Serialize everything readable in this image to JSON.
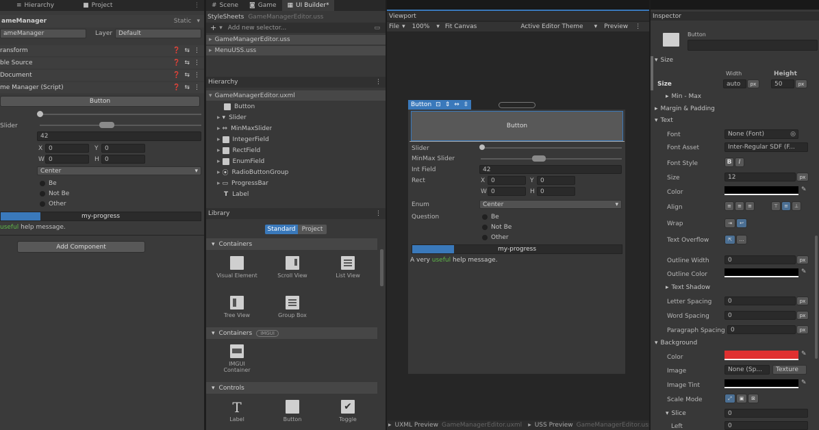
{
  "left": {
    "tabs": [
      {
        "label": "Hierarchy",
        "icon": "hierarchy-icon"
      },
      {
        "label": "Project",
        "icon": "folder-icon"
      }
    ],
    "object_name": "ameManager",
    "static_label": "Static",
    "tag_value": "ameManager",
    "layer_label": "Layer",
    "layer_value": "Default",
    "components": [
      "ransform",
      "ble Source",
      "Document",
      "me Manager (Script)"
    ],
    "preview_button": "Button",
    "slider_label": "Slider",
    "int_value": "42",
    "rect": {
      "x_label": "X",
      "x": "0",
      "y_label": "Y",
      "y": "0",
      "w_label": "W",
      "w": "0",
      "h_label": "H",
      "h": "0"
    },
    "enum_value": "Center",
    "radios": [
      "Be",
      "Not Be",
      "Other"
    ],
    "progress_title": "my-progress",
    "progress_value": 0.2,
    "help_highlight": "useful",
    "help_rest": " help message.",
    "add_component": "Add Component"
  },
  "middle": {
    "tabs": [
      {
        "label": "Scene",
        "icon": "scene-icon"
      },
      {
        "label": "Game",
        "icon": "game-icon"
      },
      {
        "label": "UI Builder*",
        "icon": "ui-builder-icon"
      }
    ],
    "stylesheets_title": "StyleSheets",
    "stylesheets_file": "GameManagerEditor.uss",
    "add_selector_placeholder": "Add new selector...",
    "stylesheet_items": [
      "GameManagerEditor.uss",
      "MenuUSS.uss"
    ],
    "hierarchy_title": "Hierarchy",
    "hierarchy_root": "GameManagerEditor.uxml",
    "hierarchy_items": [
      {
        "label": "Button",
        "icon": "button-element-icon"
      },
      {
        "label": "Slider",
        "icon": "slider-element-icon"
      },
      {
        "label": "MinMaxSlider",
        "icon": "minmax-slider-icon"
      },
      {
        "label": "IntegerField",
        "icon": "integer-field-icon"
      },
      {
        "label": "RectField",
        "icon": "rect-field-icon"
      },
      {
        "label": "EnumField",
        "icon": "enum-field-icon"
      },
      {
        "label": "RadioButtonGroup",
        "icon": "radio-group-icon"
      },
      {
        "label": "ProgressBar",
        "icon": "progress-bar-icon"
      },
      {
        "label": "Label",
        "icon": "label-element-icon"
      }
    ],
    "library_title": "Library",
    "library_tabs": [
      "Standard",
      "Project"
    ],
    "sections": [
      {
        "label": "Containers",
        "badge": "",
        "items": [
          {
            "label": "Visual Element",
            "icon": "visual-element-icon"
          },
          {
            "label": "Scroll View",
            "icon": "scroll-view-icon"
          },
          {
            "label": "List View",
            "icon": "list-view-icon"
          },
          {
            "label": "Tree View",
            "icon": "tree-view-icon"
          },
          {
            "label": "Group Box",
            "icon": "group-box-icon"
          }
        ]
      },
      {
        "label": "Containers",
        "badge": "IMGUI",
        "items": [
          {
            "label": "IMGUI Container",
            "icon": "imgui-container-icon"
          }
        ]
      },
      {
        "label": "Controls",
        "badge": "",
        "items": [
          {
            "label": "Label",
            "icon": "label-icon"
          },
          {
            "label": "Button",
            "icon": "button-icon"
          },
          {
            "label": "Toggle",
            "icon": "toggle-icon"
          }
        ]
      }
    ]
  },
  "viewport": {
    "title": "Viewport",
    "toolbar": {
      "file": "File",
      "zoom": "100%",
      "fit": "Fit Canvas",
      "theme": "Active Editor Theme",
      "preview": "Preview"
    },
    "selection_tag": "Button",
    "canvas_button": "Button",
    "slider_label": "Slider",
    "minmax_label": "MinMax Slider",
    "int_label": "Int Field",
    "int_value": "42",
    "rect_label": "Rect",
    "rect": {
      "x_label": "X",
      "x": "0",
      "y_label": "Y",
      "y": "0",
      "w_label": "W",
      "w": "0",
      "h_label": "H",
      "h": "0"
    },
    "enum_label": "Enum",
    "enum_value": "Center",
    "question_label": "Question",
    "radios": [
      "Be",
      "Not Be",
      "Other"
    ],
    "progress_title": "my-progress",
    "progress_value": 0.2,
    "help_prefix": "A very ",
    "help_highlight": "useful",
    "help_rest": " help message.",
    "bottom_tabs": [
      {
        "label": "UXML Preview",
        "file": "GameManagerEditor.uxml"
      },
      {
        "label": "USS Preview",
        "file": "GameManagerEditor.uss"
      }
    ]
  },
  "inspector": {
    "title": "Inspector",
    "element_type": "Button",
    "size_section": "Size",
    "size_label": "Size",
    "width_label": "Width",
    "height_label": "Height",
    "width_value": "auto",
    "height_value": "50",
    "unit": "px",
    "minmax_label": "Min - Max",
    "margin_section": "Margin & Padding",
    "text_section": "Text",
    "font_label": "Font",
    "font_value": "None (Font)",
    "font_asset_label": "Font Asset",
    "font_asset_value": "Inter-Regular SDF (F...",
    "font_style_label": "Font Style",
    "font_style_b": "B",
    "font_style_i": "I",
    "size_text_label": "Size",
    "size_text_value": "12",
    "color_label": "Color",
    "align_label": "Align",
    "wrap_label": "Wrap",
    "overflow_label": "Text Overflow",
    "outline_width_label": "Outline Width",
    "outline_width_value": "0",
    "outline_color_label": "Outline Color",
    "text_shadow_label": "Text Shadow",
    "letter_spacing_label": "Letter Spacing",
    "letter_spacing_value": "0",
    "word_spacing_label": "Word Spacing",
    "word_spacing_value": "0",
    "paragraph_spacing_label": "Paragraph Spacing",
    "paragraph_spacing_value": "0",
    "background_section": "Background",
    "bg_color_label": "Color",
    "bg_color": "#e03030",
    "image_label": "Image",
    "image_value": "None (Sp...",
    "image_type": "Texture",
    "image_tint_label": "Image Tint",
    "scale_mode_label": "Scale Mode",
    "slice_label": "Slice",
    "slice_value": "0",
    "left_label": "Left",
    "left_value": "0"
  },
  "colors": {
    "accent": "#3a79bb",
    "selection": "#2c5d87",
    "help_green": "#5fb84a",
    "bg_red": "#e03030"
  }
}
